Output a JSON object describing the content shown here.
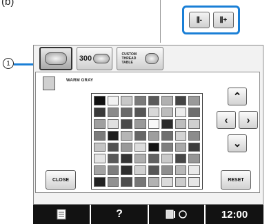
{
  "caption": "(b)",
  "zoom": {
    "minus_label": "⫼-",
    "plus_label": "⫼+"
  },
  "tabs": [
    {
      "label": "",
      "icon": "thread-spool-icon",
      "selected": true
    },
    {
      "label": "300",
      "icon": "thread-spool-icon"
    },
    {
      "label": "CUSTOM THREAD TABLE",
      "icon": "thread-spool-icon"
    }
  ],
  "current_color": {
    "name": "WARM GRAY",
    "swatch": "#d0d0d0"
  },
  "palette": [
    [
      "#111111",
      "#f2f2f2",
      "#c8c8c8",
      "#7a7a7a",
      "#5a5a5a",
      "#b0b0b0",
      "#444444",
      "#9a9a9a"
    ],
    [
      "#3a3a3a",
      "#8a8a8a",
      "#6a6a6a",
      "#555555",
      "#d8d8d8",
      "#bcbcbc",
      "#ececec",
      "#6e6e6e"
    ],
    [
      "#a0a0a0",
      "#e0e0e0",
      "#4a4a4a",
      "#999999",
      "#f8f8f8",
      "#2a2a2a",
      "#bdbdbd",
      "#cfcfcf"
    ],
    [
      "#7c7c7c",
      "#1e1e1e",
      "#b5b5b5",
      "#666666",
      "#9e9e9e",
      "#707070",
      "#d4d4d4",
      "#8c8c8c"
    ],
    [
      "#c4c4c4",
      "#525252",
      "#9a9a9a",
      "#dcdcdc",
      "#131313",
      "#7f7f7f",
      "#a9a9a9",
      "#3c3c3c"
    ],
    [
      "#e4e4e4",
      "#595959",
      "#353535",
      "#adadad",
      "#626262",
      "#c9c9c9",
      "#464646",
      "#959595"
    ],
    [
      "#a3a3a3",
      "#7d7d7d",
      "#2f2f2f",
      "#d0d0d0",
      "#575757",
      "#8e8e8e",
      "#b8b8b8",
      "#e9e9e9"
    ],
    [
      "#222222",
      "#919191",
      "#4e4e4e",
      "#767676",
      "#b2b2b2",
      "#dadada",
      "#cccccc",
      "#e6e6e6"
    ]
  ],
  "buttons": {
    "close": "CLOSE",
    "reset": "RESET"
  },
  "statusbar": {
    "help": "?",
    "time": "12:00"
  },
  "callout": {
    "number": "1"
  },
  "colors": {
    "accent": "#1a7fd6",
    "bar": "#121212"
  }
}
